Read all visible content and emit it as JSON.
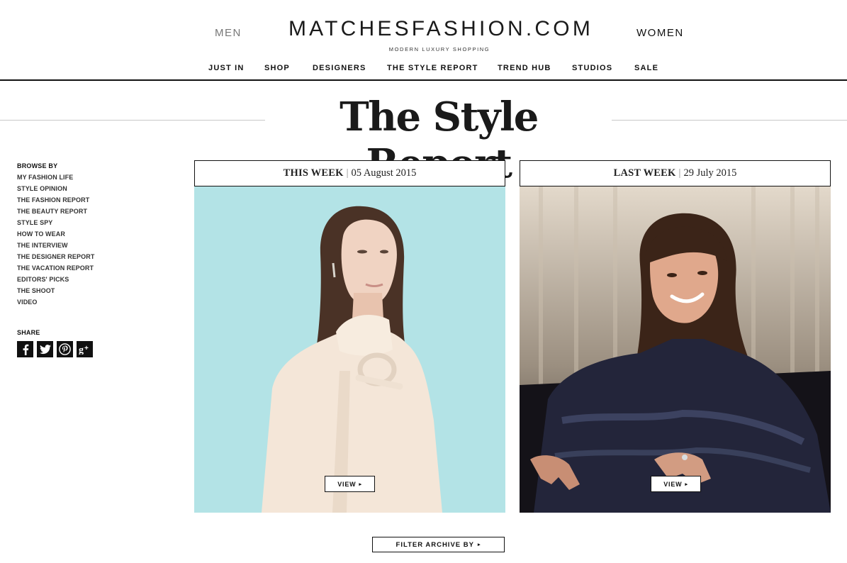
{
  "header": {
    "men_label": "MEN",
    "women_label": "WOMEN",
    "logo": "MATCHESFASHION.COM",
    "tagline": "MODERN LUXURY SHOPPING",
    "nav": [
      "JUST IN",
      "SHOP",
      "DESIGNERS",
      "THE STYLE REPORT",
      "TREND HUB",
      "STUDIOS",
      "SALE"
    ]
  },
  "page_title": "The Style Report",
  "sidebar": {
    "browse_heading": "BROWSE BY",
    "items": [
      "MY FASHION LIFE",
      "STYLE OPINION",
      "THE FASHION REPORT",
      "THE BEAUTY REPORT",
      "STYLE SPY",
      "HOW TO WEAR",
      "THE INTERVIEW",
      "THE DESIGNER REPORT",
      "THE VACATION REPORT",
      "EDITORS' PICKS",
      "THE SHOOT",
      "VIDEO"
    ],
    "share_heading": "SHARE",
    "share_icons": [
      "facebook-icon",
      "twitter-icon",
      "pinterest-icon",
      "google-plus-icon"
    ]
  },
  "cards": [
    {
      "week_label": "THIS WEEK",
      "separator": "|",
      "date": "05 August 2015",
      "view_label": "VIEW",
      "bg_color": "#a9dfe2"
    },
    {
      "week_label": "LAST WEEK",
      "separator": "|",
      "date": "29 July 2015",
      "view_label": "VIEW",
      "bg_color": "#1c1a22"
    }
  ],
  "filter_label": "FILTER ARCHIVE BY",
  "colors": {
    "text": "#111111",
    "rule": "#c9c9c9",
    "muted": "#777777"
  }
}
